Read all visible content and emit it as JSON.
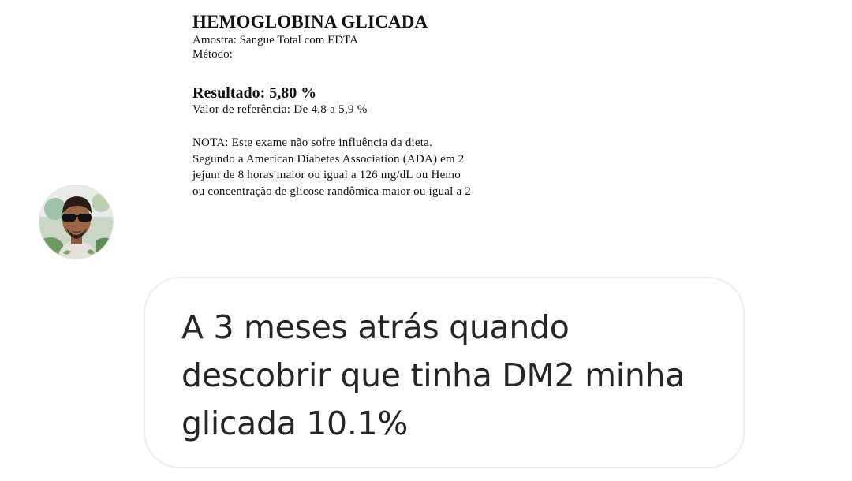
{
  "document_image": {
    "title": "HEMOGLOBINA GLICADA",
    "sample": "Amostra: Sangue Total com EDTA",
    "method": "Método:",
    "result": "Resultado: 5,80 %",
    "reference": "Valor de referência:  De 4,8  a  5,9 %",
    "note_lines": [
      "NOTA:  Este exame não sofre influência da dieta.",
      "Segundo a American Diabetes Association (ADA) em 2",
      "jejum de 8 horas maior ou igual a 126 mg/dL ou Hemo",
      "ou concentração de glicose randômica maior ou igual a 2"
    ]
  },
  "message": {
    "text": "A 3 meses atrás quando descobrir que tinha DM2 minha glicada 10.1%"
  },
  "avatar": {
    "icon": "profile-photo"
  }
}
